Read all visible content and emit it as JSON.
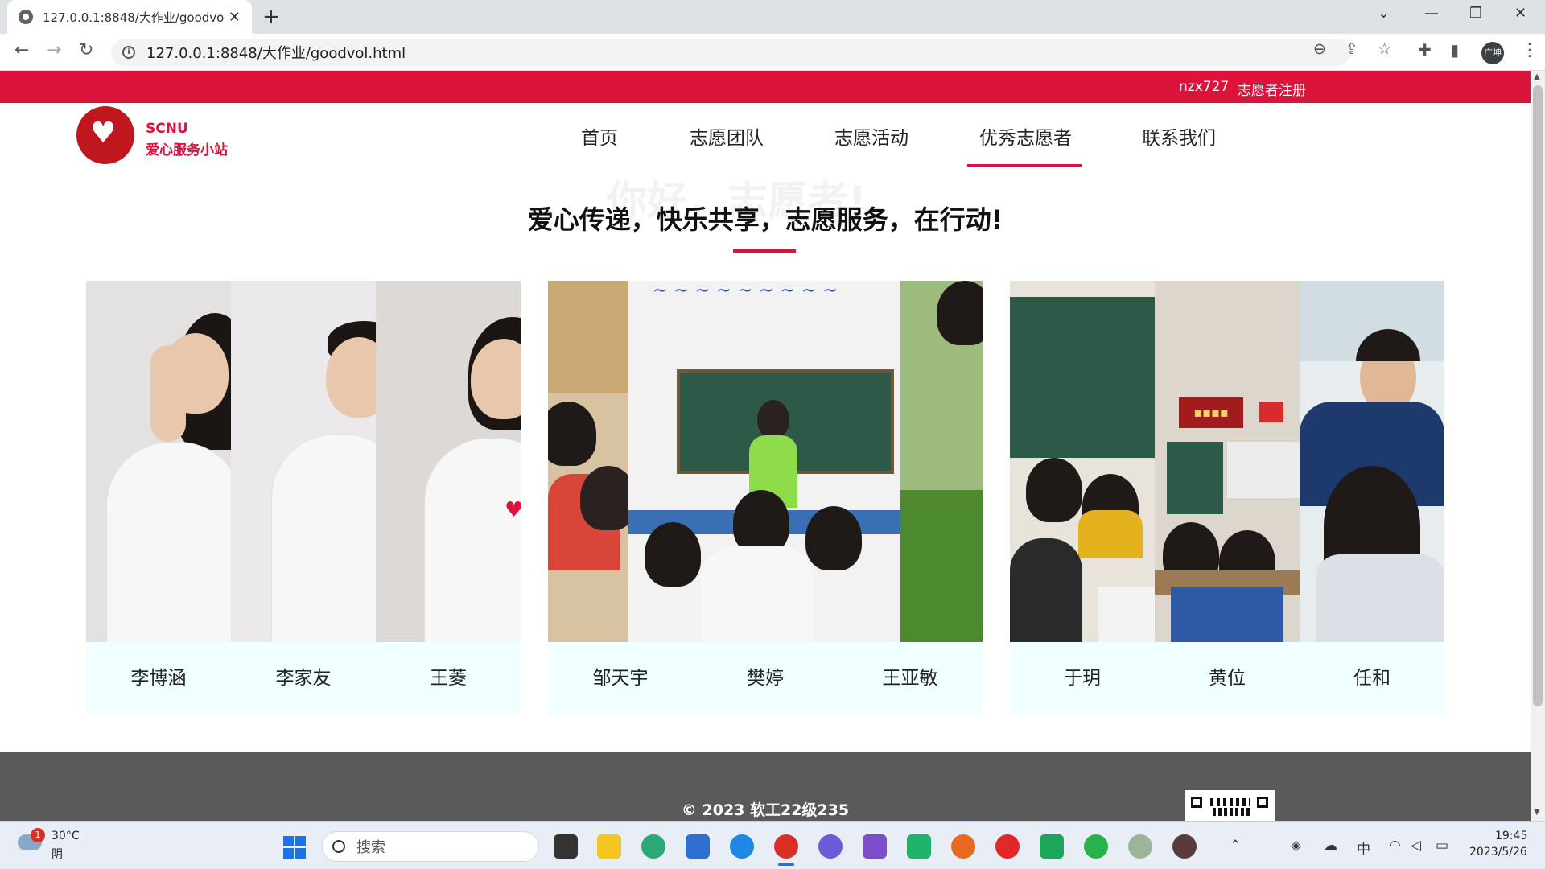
{
  "browser": {
    "tab_title": "127.0.0.1:8848/大作业/goodvol.html",
    "url": "127.0.0.1:8848/大作业/goodvol.html",
    "profile_label": "广坤"
  },
  "site": {
    "top_user": "nzx727",
    "top_register": "志愿者注册",
    "brand_en": "SCNU",
    "brand_cn": "爱心服务小站",
    "nav": [
      "首页",
      "志愿团队",
      "志愿活动",
      "优秀志愿者",
      "联系我们"
    ],
    "active_nav": "优秀志愿者",
    "watermark": "你好，志愿者!",
    "slogan": "爱心传递，快乐共享，志愿服务，在行动!",
    "cards": [
      {
        "names": [
          "李博涵",
          "李家友",
          "王菱"
        ]
      },
      {
        "names": [
          "邹天宇",
          "樊婷",
          "王亚敏"
        ]
      },
      {
        "names": [
          "于玥",
          "黄位",
          "任和"
        ]
      }
    ],
    "footer_copyright": "© 2023 软工22级235"
  },
  "taskbar": {
    "weather_badge": "1",
    "weather_temp": "30°C",
    "weather_desc": "阴",
    "search_placeholder": "搜索",
    "ime": "中",
    "time": "19:45",
    "date": "2023/5/26"
  },
  "colors": {
    "accent": "#dc143c",
    "card_bg": "#f0ffff",
    "footer_bg": "#5a5a5a"
  }
}
